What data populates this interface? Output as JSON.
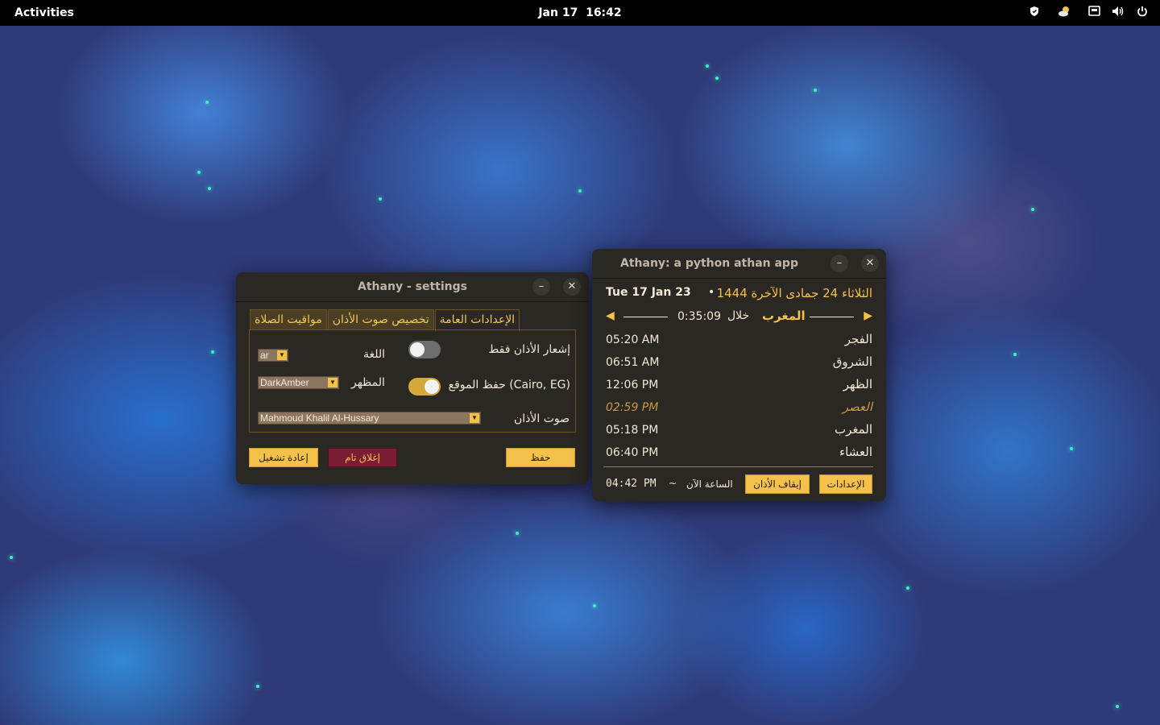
{
  "topbar": {
    "activities": "Activities",
    "date": "Jan 17",
    "time": "16:42",
    "tray_icons": [
      "shield-icon",
      "weather-icon",
      "network-icon",
      "volume-icon",
      "power-icon"
    ]
  },
  "settings_window": {
    "title": "Athany - settings",
    "minimize": "–",
    "close": "✕",
    "tabs": [
      {
        "label": "الإعدادات العامة",
        "active": true
      },
      {
        "label": "تخصيص صوت الأذان",
        "active": false
      },
      {
        "label": "مواقيت الصلاة",
        "active": false
      }
    ],
    "notify_only_label": "إشعار الأذان فقط",
    "notify_only_on": false,
    "language_label": "اللغة",
    "language_value": "ar",
    "save_location_label": "حفظ الموقع (Cairo, EG)",
    "save_location_on": true,
    "theme_label": "المظهر",
    "theme_value": "DarkAmber",
    "athan_sound_label": "صوت الأذان",
    "athan_sound_value": "Mahmoud Khalil Al-Hussary",
    "save_button": "حفظ",
    "full_close_button": "إغلاق تام",
    "restart_button": "إعادة تشغيل"
  },
  "main_window": {
    "title": "Athany: a python athan app",
    "minimize": "–",
    "close": "✕",
    "gregorian_date": "Tue 17 Jan 23",
    "separator": "•",
    "hijri_date": "الثلاثاء 24 جمادى الآخرة 1444",
    "next_prayer_name": "المغرب",
    "in_label": "خلال",
    "countdown": "0:35:09",
    "prayers": [
      {
        "name": "الفجر",
        "time": "05:20 AM",
        "current": false
      },
      {
        "name": "الشروق",
        "time": "06:51 AM",
        "current": false
      },
      {
        "name": "الظهر",
        "time": "12:06 PM",
        "current": false
      },
      {
        "name": "العصر",
        "time": "02:59 PM",
        "current": true
      },
      {
        "name": "المغرب",
        "time": "05:18 PM",
        "current": false
      },
      {
        "name": "العشاء",
        "time": "06:40 PM",
        "current": false
      }
    ],
    "current_time": "04:42 PM",
    "tilde": "~",
    "now_label": "الساعة الآن",
    "stop_athan_button": "إيقاف الأذان",
    "settings_button": "الإعدادات"
  },
  "colors": {
    "accent": "#f4c14a",
    "window_bg": "#2b2722",
    "wine": "#7a1c33",
    "current_prayer": "#c79a4a",
    "wallpaper_base": "#2f3a78"
  }
}
